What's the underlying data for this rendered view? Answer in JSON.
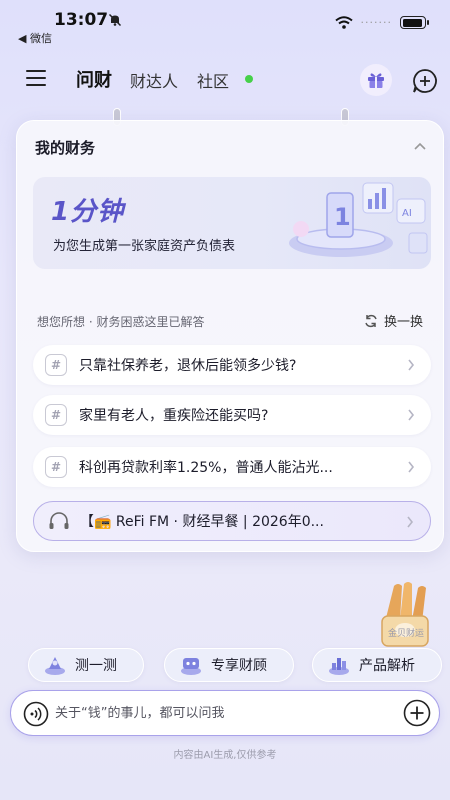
{
  "status_bar": {
    "time": "13:07",
    "back_app": "◀ 微信",
    "signal": "·······",
    "battery_level": 0.95
  },
  "nav": {
    "tabs": [
      {
        "label": "问财",
        "active": true
      },
      {
        "label": "财达人",
        "active": false
      },
      {
        "label": "社区",
        "active": false
      }
    ],
    "icons": [
      "menu-icon",
      "gift-icon",
      "chat-add-icon"
    ]
  },
  "finance_card": {
    "title": "我的财务",
    "banner": {
      "headline": "1分钟",
      "subtitle": "为您生成第一张家庭资产负债表",
      "art_text": "AI"
    },
    "suggestions_heading": "想您所想 · 财务困惑这里已解答",
    "refresh_label": "换一换",
    "questions": [
      "只靠社保养老，退休后能领多少钱?",
      "家里有老人，重疾险还能买吗?",
      "科创再贷款利率1.25%，普通人能沾光..."
    ],
    "fm_item": "【📻 ReFi FM · 财经早餐 | 2026年0..."
  },
  "mascot_caption": "金贝财运",
  "quick_actions": [
    {
      "label": "测一测",
      "icon": "test-icon"
    },
    {
      "label": "专享财顾",
      "icon": "advisor-icon"
    },
    {
      "label": "产品解析",
      "icon": "chart-icon"
    }
  ],
  "input": {
    "placeholder": "关于“钱”的事儿，都可以问我"
  },
  "disclaimer": "内容由AI生成,仅供参考",
  "colors": {
    "accent": "#5a55c8",
    "online": "#46d04a",
    "input_border": "#a9a2ea"
  }
}
